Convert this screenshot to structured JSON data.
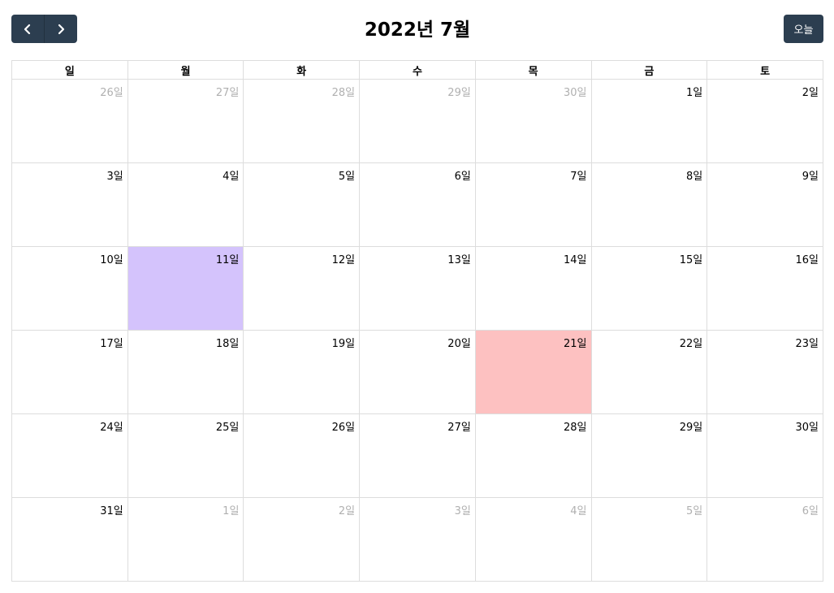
{
  "toolbar": {
    "prev_icon": "chevron-left-icon",
    "next_icon": "chevron-right-icon",
    "title": "2022년 7월",
    "today_label": "오늘",
    "button_color": "#2c3e50"
  },
  "weekdays": [
    "일",
    "월",
    "화",
    "수",
    "목",
    "금",
    "토"
  ],
  "weeks": [
    [
      {
        "label": "26일",
        "other": true
      },
      {
        "label": "27일",
        "other": true
      },
      {
        "label": "28일",
        "other": true
      },
      {
        "label": "29일",
        "other": true
      },
      {
        "label": "30일",
        "other": true
      },
      {
        "label": "1일",
        "other": false
      },
      {
        "label": "2일",
        "other": false
      }
    ],
    [
      {
        "label": "3일",
        "other": false
      },
      {
        "label": "4일",
        "other": false
      },
      {
        "label": "5일",
        "other": false
      },
      {
        "label": "6일",
        "other": false
      },
      {
        "label": "7일",
        "other": false
      },
      {
        "label": "8일",
        "other": false
      },
      {
        "label": "9일",
        "other": false
      }
    ],
    [
      {
        "label": "10일",
        "other": false
      },
      {
        "label": "11일",
        "other": false,
        "highlight": "purple"
      },
      {
        "label": "12일",
        "other": false
      },
      {
        "label": "13일",
        "other": false
      },
      {
        "label": "14일",
        "other": false
      },
      {
        "label": "15일",
        "other": false
      },
      {
        "label": "16일",
        "other": false
      }
    ],
    [
      {
        "label": "17일",
        "other": false
      },
      {
        "label": "18일",
        "other": false
      },
      {
        "label": "19일",
        "other": false
      },
      {
        "label": "20일",
        "other": false
      },
      {
        "label": "21일",
        "other": false,
        "highlight": "pink"
      },
      {
        "label": "22일",
        "other": false
      },
      {
        "label": "23일",
        "other": false
      }
    ],
    [
      {
        "label": "24일",
        "other": false
      },
      {
        "label": "25일",
        "other": false
      },
      {
        "label": "26일",
        "other": false
      },
      {
        "label": "27일",
        "other": false
      },
      {
        "label": "28일",
        "other": false
      },
      {
        "label": "29일",
        "other": false
      },
      {
        "label": "30일",
        "other": false
      }
    ],
    [
      {
        "label": "31일",
        "other": false
      },
      {
        "label": "1일",
        "other": true
      },
      {
        "label": "2일",
        "other": true
      },
      {
        "label": "3일",
        "other": true
      },
      {
        "label": "4일",
        "other": true
      },
      {
        "label": "5일",
        "other": true
      },
      {
        "label": "6일",
        "other": true
      }
    ]
  ],
  "colors": {
    "highlight_purple": "#d4c3fc",
    "highlight_pink": "#fdc1c1",
    "other_month_text": "#b0b0b0",
    "grid_border": "#dddddd"
  }
}
